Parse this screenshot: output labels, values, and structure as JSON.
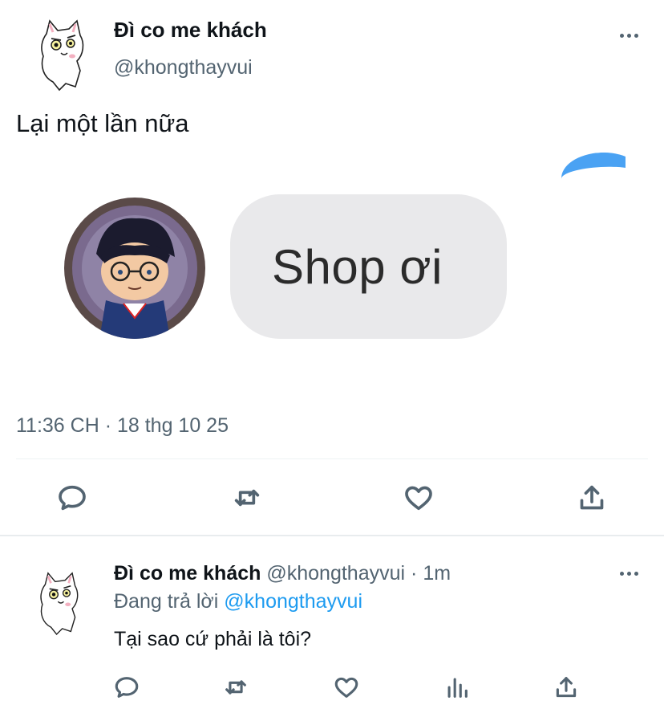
{
  "tweet": {
    "author_name": "Đì co me khách",
    "author_handle": "@khongthayvui",
    "text": "Lại một lần nữa",
    "media": {
      "bubble_text": "Shop ơi"
    },
    "timestamp": "11:36 CH · 18 thg 10 25",
    "actions": [
      "reply-icon",
      "retweet-icon",
      "like-icon",
      "share-icon"
    ]
  },
  "reply": {
    "author_name": "Đì co me khách",
    "author_handle": "@khongthayvui",
    "separator": "·",
    "time": "1m",
    "replying_prefix": "Đang trả lời",
    "replying_to": "@khongthayvui",
    "text": "Tại sao cứ phải là tôi?",
    "actions": [
      "reply-icon",
      "retweet-icon",
      "like-icon",
      "analytics-icon",
      "share-icon"
    ]
  },
  "colors": {
    "accent": "#1d9bf0",
    "secondary_text": "#536471",
    "bubble": "#e9e9eb"
  }
}
